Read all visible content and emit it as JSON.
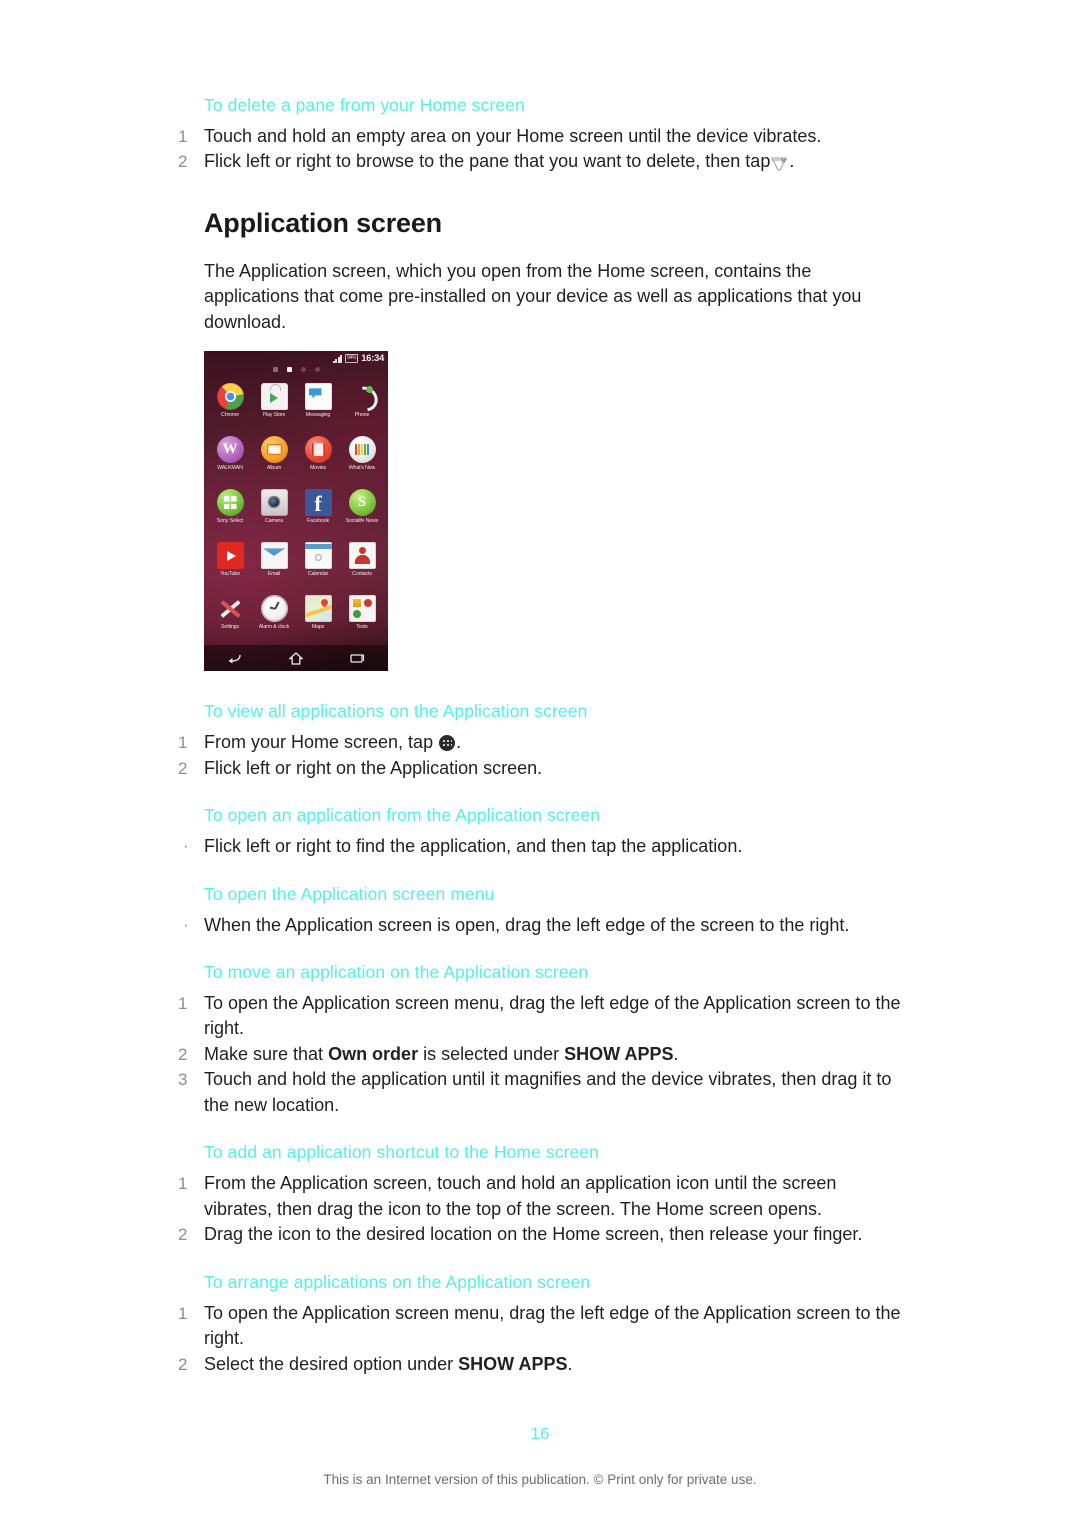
{
  "document": {
    "page_number": "16",
    "footer_note": "This is an Internet version of this publication. © Print only for private use."
  },
  "sections": {
    "delete_pane": {
      "title": "To delete a pane from your Home screen",
      "steps": [
        {
          "num": "1",
          "text": "Touch and hold an empty area on your Home screen until the device vibrates."
        },
        {
          "num": "2",
          "text_before": "Flick left or right to browse to the pane that you want to delete, then tap",
          "icon": "delete-pane-icon",
          "text_after": "."
        }
      ]
    },
    "application_screen": {
      "heading": "Application screen",
      "intro": "The Application screen, which you open from the Home screen, contains the applications that come pre-installed on your device as well as applications that you download."
    },
    "view_all": {
      "title": "To view all applications on the Application screen",
      "steps": [
        {
          "num": "1",
          "text_before": "From your Home screen, tap",
          "icon": "app-drawer-icon",
          "text_after": "."
        },
        {
          "num": "2",
          "text": "Flick left or right on the Application screen."
        }
      ]
    },
    "open_application": {
      "title": "To open an application from the Application screen",
      "bullets": [
        {
          "text": "Flick left or right to find the application, and then tap the application."
        }
      ]
    },
    "open_menu": {
      "title": "To open the Application screen menu",
      "bullets": [
        {
          "text": "When the Application screen is open, drag the left edge of the screen to the right."
        }
      ]
    },
    "move_application": {
      "title": "To move an application on the Application screen",
      "steps": [
        {
          "num": "1",
          "text": "To open the Application screen menu, drag the left edge of the Application screen to the right."
        },
        {
          "num": "2",
          "text_before": "Make sure that ",
          "bold1": "Own order",
          "text_mid": " is selected under ",
          "bold2": "SHOW APPS",
          "text_after": "."
        },
        {
          "num": "3",
          "text": "Touch and hold the application until it magnifies and the device vibrates, then drag it to the new location."
        }
      ]
    },
    "add_shortcut": {
      "title": "To add an application shortcut to the Home screen",
      "steps": [
        {
          "num": "1",
          "text": "From the Application screen, touch and hold an application icon until the screen vibrates, then drag the icon to the top of the screen. The Home screen opens."
        },
        {
          "num": "2",
          "text": "Drag the icon to the desired location on the Home screen, then release your finger."
        }
      ]
    },
    "arrange_applications": {
      "title": "To arrange applications on the Application screen",
      "steps": [
        {
          "num": "1",
          "text": "To open the Application screen menu, drag the left edge of the Application screen to the right."
        },
        {
          "num": "2",
          "text_before": "Select the desired option under ",
          "bold1": "SHOW APPS",
          "text_after": "."
        }
      ]
    }
  },
  "figure": {
    "caption": "",
    "status_bar": {
      "signal": "signal-icon",
      "battery": "94%",
      "clock": "16:34"
    },
    "page_indicator": {
      "count": 4,
      "active_index": 1
    },
    "apps": [
      {
        "label": "Chrome",
        "icon": "chrome-icon"
      },
      {
        "label": "Play Store",
        "icon": "play-store-icon"
      },
      {
        "label": "Messaging",
        "icon": "messaging-icon"
      },
      {
        "label": "Phone",
        "icon": "phone-icon"
      },
      {
        "label": "WALKMAN",
        "icon": "walkman-icon"
      },
      {
        "label": "Album",
        "icon": "album-icon"
      },
      {
        "label": "Movies",
        "icon": "movies-icon"
      },
      {
        "label": "What's New",
        "icon": "whats-new-icon"
      },
      {
        "label": "Sony Select",
        "icon": "sony-select-icon"
      },
      {
        "label": "Camera",
        "icon": "camera-icon"
      },
      {
        "label": "Facebook",
        "icon": "facebook-icon"
      },
      {
        "label": "Socialife News",
        "icon": "socialife-news-icon"
      },
      {
        "label": "YouTube",
        "icon": "youtube-icon"
      },
      {
        "label": "Email",
        "icon": "email-icon"
      },
      {
        "label": "Calendar",
        "icon": "calendar-icon"
      },
      {
        "label": "Contacts",
        "icon": "contacts-icon"
      },
      {
        "label": "Settings",
        "icon": "settings-icon"
      },
      {
        "label": "Alarm & clock",
        "icon": "alarm-clock-icon"
      },
      {
        "label": "Maps",
        "icon": "maps-icon"
      },
      {
        "label": "Tools",
        "icon": "tools-icon"
      }
    ],
    "navbar": [
      "back-icon",
      "home-icon",
      "recents-icon"
    ]
  },
  "colors": {
    "heading_accent": "#4ff3e4",
    "body_text": "#221f1f",
    "step_number": "#8e8e8e",
    "footer_text": "#6f6c6e",
    "phone_wallpaper": "#5e2133"
  }
}
